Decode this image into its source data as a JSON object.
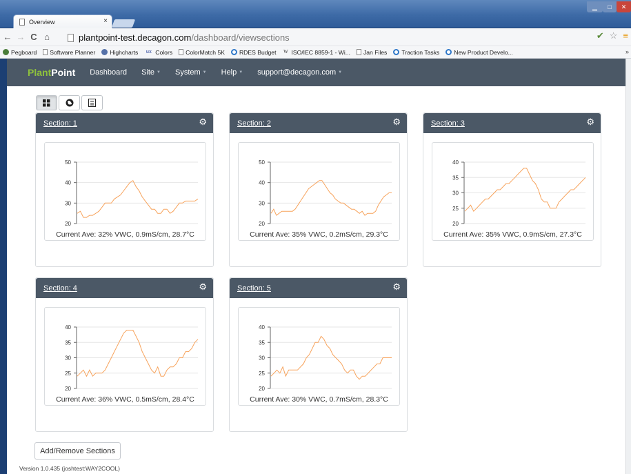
{
  "browser": {
    "tab_title": "Overview",
    "tab_close": "×",
    "url_host": "plantpoint-test.decagon.com",
    "url_path": "/dashboard/viewsections",
    "bookmarks": [
      "Pegboard",
      "Software Planner",
      "Highcharts",
      "Colors",
      "ColorMatch 5K",
      "RDES Budget",
      "ISO/IEC 8859-1 - Wi...",
      "Jan Files",
      "Traction Tasks",
      "New Product Develo..."
    ],
    "bookmark_icons": [
      "globe-icon",
      "page-icon",
      "highcharts-icon",
      "ux-icon",
      "page-icon",
      "blue-circle-icon",
      "wikipedia-icon",
      "page-icon",
      "blue-circle-icon",
      "blue-circle-icon"
    ],
    "bookmark_ux_glyph": "ux",
    "bookmark_w_glyph": "W",
    "more": "»"
  },
  "nav": {
    "brand_a": "Plant",
    "brand_b": "Point",
    "items": [
      {
        "label": "Dashboard",
        "caret": ""
      },
      {
        "label": "Site",
        "caret": "▼"
      },
      {
        "label": "System",
        "caret": "▼"
      },
      {
        "label": "Help",
        "caret": "▼"
      },
      {
        "label": "support@decagon.com",
        "caret": "▼"
      }
    ]
  },
  "colors": {
    "navbar": "#4b5866",
    "brand_green": "#8ec13d",
    "series": "#f7a35c"
  },
  "actions": {
    "add_remove": "Add/Remove Sections"
  },
  "footer": {
    "version": "Version 1.0.435 (joshtest:WAY2COOL)"
  },
  "chart_data": [
    {
      "type": "line",
      "title": "Section: 1",
      "caption": "Current Ave: 32% VWC, 0.9mS/cm, 28.7°C",
      "ylim": [
        20,
        50
      ],
      "yticks": [
        20,
        30,
        40,
        50
      ],
      "values": [
        25,
        26,
        23,
        23,
        24,
        24,
        25,
        26,
        28,
        30,
        30,
        30,
        32,
        33,
        34,
        36,
        38,
        40,
        41,
        38,
        36,
        33,
        31,
        29,
        27,
        27,
        25,
        25,
        27,
        27,
        25,
        26,
        28,
        30,
        30,
        31,
        31,
        31,
        31,
        32
      ]
    },
    {
      "type": "line",
      "title": "Section: 2",
      "caption": "Current Ave: 35% VWC, 0.2mS/cm, 29.3°C",
      "ylim": [
        20,
        50
      ],
      "yticks": [
        20,
        30,
        40,
        50
      ],
      "values": [
        25,
        27,
        24,
        25,
        26,
        26,
        26,
        26,
        26,
        27,
        29,
        31,
        33,
        35,
        37,
        38,
        39,
        40,
        41,
        41,
        39,
        37,
        35,
        34,
        32,
        31,
        30,
        30,
        29,
        28,
        27,
        27,
        26,
        25,
        26,
        24,
        25,
        25,
        25,
        26,
        29,
        31,
        33,
        34,
        35,
        35
      ]
    },
    {
      "type": "line",
      "title": "Section: 3",
      "caption": "Current Ave: 35% VWC, 0.9mS/cm, 27.3°C",
      "ylim": [
        20,
        40
      ],
      "yticks": [
        20,
        25,
        30,
        35,
        40
      ],
      "values": [
        24,
        25,
        26,
        24,
        25,
        26,
        27,
        28,
        28,
        29,
        30,
        31,
        31,
        32,
        33,
        33,
        34,
        35,
        36,
        37,
        38,
        38,
        36,
        34,
        33,
        31,
        28,
        27,
        27,
        25,
        25,
        25,
        27,
        28,
        29,
        30,
        31,
        31,
        32,
        33,
        34,
        35
      ]
    },
    {
      "type": "line",
      "title": "Section: 4",
      "caption": "Current Ave: 36% VWC, 0.5mS/cm, 28.4°C",
      "ylim": [
        20,
        40
      ],
      "yticks": [
        20,
        25,
        30,
        35,
        40
      ],
      "values": [
        24,
        25,
        26,
        24,
        26,
        24,
        25,
        25,
        25,
        26,
        28,
        30,
        32,
        34,
        36,
        38,
        39,
        39,
        39,
        37,
        35,
        32,
        30,
        28,
        26,
        25,
        27,
        24,
        24,
        26,
        27,
        27,
        28,
        30,
        30,
        32,
        32,
        33,
        35,
        36
      ]
    },
    {
      "type": "line",
      "title": "Section: 5",
      "caption": "Current Ave: 30% VWC, 0.7mS/cm, 28.3°C",
      "ylim": [
        20,
        40
      ],
      "yticks": [
        20,
        25,
        30,
        35,
        40
      ],
      "values": [
        24,
        25,
        26,
        25,
        27,
        24,
        26,
        26,
        26,
        26,
        27,
        28,
        30,
        31,
        33,
        35,
        35,
        37,
        36,
        34,
        33,
        31,
        30,
        29,
        28,
        26,
        25,
        26,
        26,
        24,
        23,
        24,
        24,
        25,
        26,
        27,
        28,
        28,
        30,
        30,
        30,
        30
      ]
    }
  ]
}
